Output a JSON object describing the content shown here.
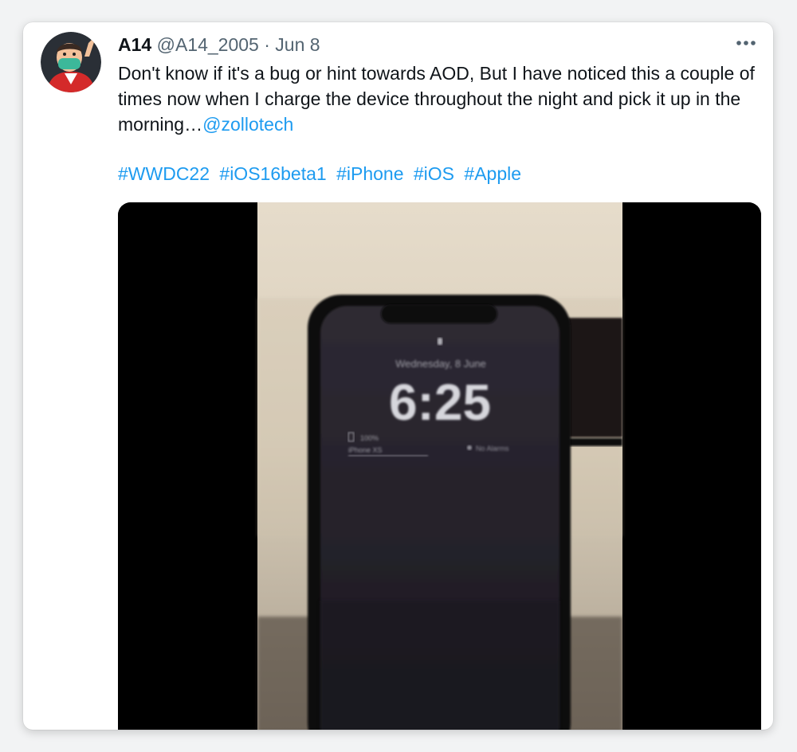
{
  "tweet": {
    "author_name": "A14",
    "author_handle": "@A14_2005",
    "separator": "·",
    "date": "Jun 8",
    "text": "Don't know if it's a bug or hint towards AOD, But I have noticed this a couple of times now when I charge the device throughout the night and pick it up in the morning…",
    "mention": "@zollotech",
    "hashtags": [
      "#WWDC22",
      "#iOS16beta1",
      "#iPhone",
      "#iOS",
      "#Apple"
    ]
  },
  "media": {
    "lock_date": "Wednesday, 8 June",
    "lock_time": "6:25",
    "battery_percent": "100%",
    "battery_device": "iPhone XS",
    "alarm_text": "No Alarms"
  },
  "colors": {
    "link": "#1d9bf0",
    "text": "#0f1419",
    "secondary": "#536471"
  },
  "icons": {
    "more": "more-horizontal-icon",
    "avatar": "memoji-avatar"
  }
}
